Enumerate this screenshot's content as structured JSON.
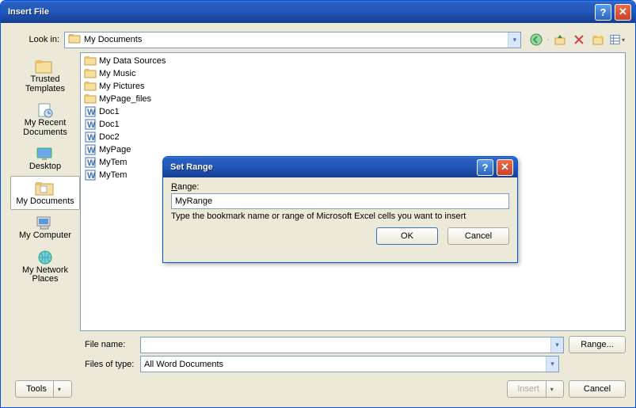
{
  "window": {
    "title": "Insert File"
  },
  "lookin": {
    "label": "Look in:",
    "value": "My Documents"
  },
  "places": [
    {
      "id": "trusted",
      "label": "Trusted Templates"
    },
    {
      "id": "recent",
      "label": "My Recent Documents"
    },
    {
      "id": "desktop",
      "label": "Desktop"
    },
    {
      "id": "mydocs",
      "label": "My Documents",
      "selected": true
    },
    {
      "id": "mycomp",
      "label": "My Computer"
    },
    {
      "id": "network",
      "label": "My Network Places"
    }
  ],
  "files": [
    {
      "name": "My Data Sources",
      "type": "folder"
    },
    {
      "name": "My Music",
      "type": "folder"
    },
    {
      "name": "My Pictures",
      "type": "folder"
    },
    {
      "name": "MyPage_files",
      "type": "folder"
    },
    {
      "name": "Doc1",
      "type": "word"
    },
    {
      "name": "Doc1",
      "type": "word"
    },
    {
      "name": "Doc2",
      "type": "word"
    },
    {
      "name": "MyPage",
      "type": "word"
    },
    {
      "name": "MyTem",
      "type": "word"
    },
    {
      "name": "MyTem",
      "type": "word"
    }
  ],
  "fields": {
    "filename_label": "File name:",
    "filename_value": "",
    "filetype_label": "Files of type:",
    "filetype_value": "All Word Documents",
    "range_button": "Range..."
  },
  "footer": {
    "tools": "Tools",
    "insert": "Insert",
    "cancel": "Cancel"
  },
  "modal": {
    "title": "Set Range",
    "label": "Range:",
    "value": "MyRange",
    "hint": "Type the bookmark name or range of Microsoft Excel cells you want to insert",
    "ok": "OK",
    "cancel": "Cancel"
  }
}
